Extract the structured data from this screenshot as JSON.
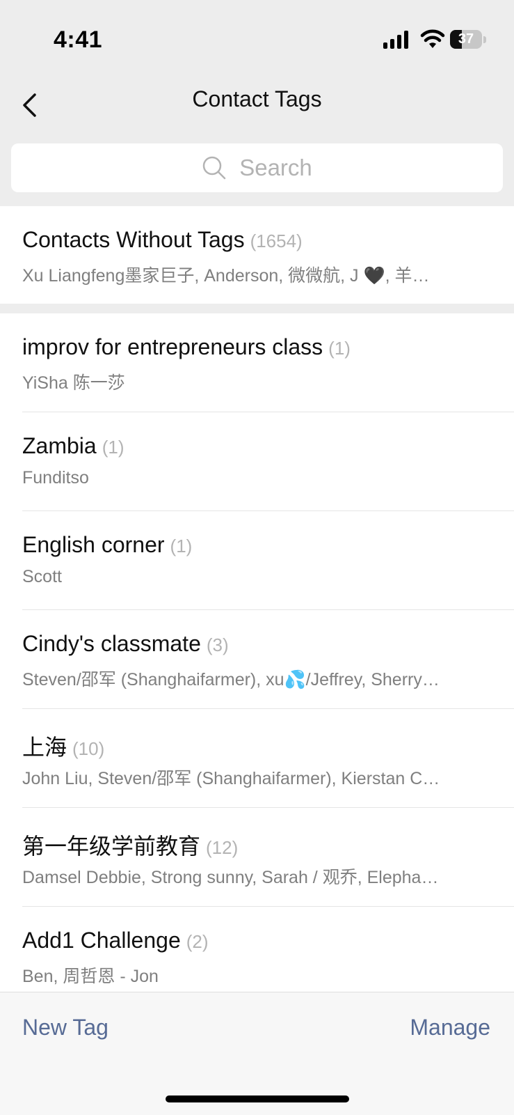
{
  "status_bar": {
    "time": "4:41",
    "battery_level": "37",
    "battery_fraction": 0.37,
    "icons": [
      "signal-icon",
      "wifi-icon",
      "battery-icon"
    ]
  },
  "nav": {
    "title": "Contact Tags",
    "back_icon": "chevron-left-icon"
  },
  "search": {
    "placeholder": "Search",
    "icon": "search-icon"
  },
  "untagged": {
    "title": "Contacts Without Tags",
    "count": "(1654)",
    "members": "Xu Liangfeng墨家巨子, Anderson, 微微航, J 🖤, 羊…"
  },
  "tags": [
    {
      "name": "improv for entrepreneurs class",
      "count": "(1)",
      "members": "YiSha 陈一莎"
    },
    {
      "name": "Zambia",
      "count": "(1)",
      "members": "Funditso"
    },
    {
      "name": "English corner",
      "count": "(1)",
      "members": "Scott"
    },
    {
      "name": "Cindy's classmate",
      "count": "(3)",
      "members": "Steven/邵军 (Shanghaifarmer), xu💦/Jeffrey, Sherry…"
    },
    {
      "name": "上海",
      "count": "(10)",
      "members": "John Liu, Steven/邵军 (Shanghaifarmer), Kierstan C…"
    },
    {
      "name": "第一年级学前教育",
      "count": "(12)",
      "members": "Damsel Debbie, Strong sunny,  Sarah / 观乔, Elepha…"
    },
    {
      "name": "Add1 Challenge",
      "count": "(2)",
      "members": "Ben, 周哲恩 - Jon"
    }
  ],
  "bottom_bar": {
    "new_tag_label": "New Tag",
    "manage_label": "Manage"
  },
  "colors": {
    "background": "#ededed",
    "link": "#576b95",
    "secondary_text": "#7f7f7f",
    "count_text": "#b3b3b3"
  }
}
